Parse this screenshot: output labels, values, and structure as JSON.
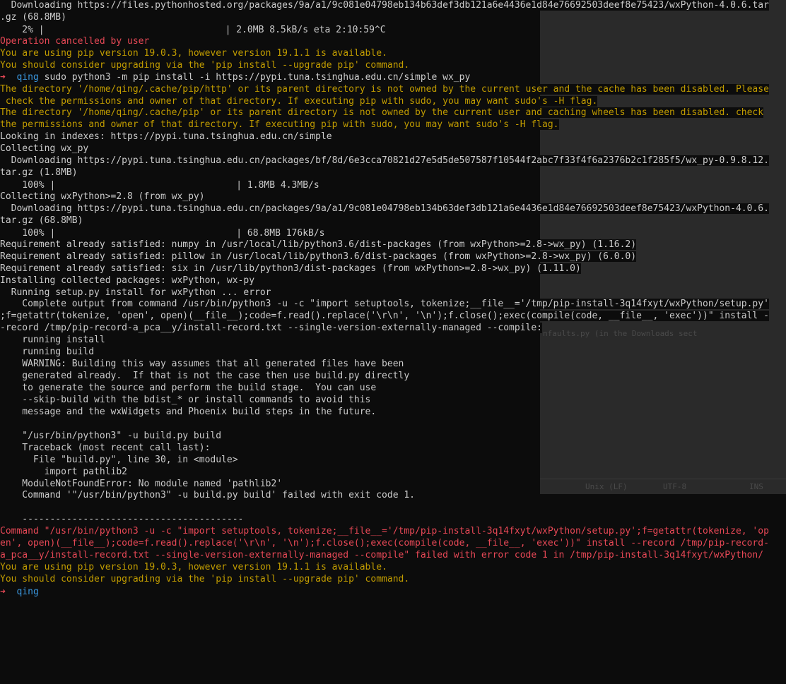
{
  "terminal": {
    "lines": [
      {
        "type": "normal",
        "text": "  Downloading https://files.pythonhosted.org/packages/9a/a1/9c081e04798eb134b63def3db121a6e4436e1d84e76692503deef8e75423/wxPython-4.0.6.tar"
      },
      {
        "type": "normal",
        "text": ".gz (68.8MB)"
      },
      {
        "type": "progress",
        "prefix": "    2% ",
        "fill": 0.02,
        "suffix": " 2.0MB 8.5kB/s eta 2:10:59^C"
      },
      {
        "type": "red",
        "text": "Operation cancelled by user"
      },
      {
        "type": "yellow",
        "text": "You are using pip version 19.0.3, however version 19.1.1 is available."
      },
      {
        "type": "yellow",
        "text": "You should consider upgrading via the 'pip install --upgrade pip' command."
      },
      {
        "type": "prompt",
        "arrow": "➜",
        "user": "qing",
        "command": " sudo python3 -m pip install -i https://pypi.tuna.tsinghua.edu.cn/simple wx_py"
      },
      {
        "type": "yellow",
        "text": "The directory '/home/qing/.cache/pip/http' or its parent directory is not owned by the current user and the cache has been disabled. Please"
      },
      {
        "type": "yellow",
        "text": " check the permissions and owner of that directory. If executing pip with sudo, you may want sudo's -H flag."
      },
      {
        "type": "yellow",
        "text": "The directory '/home/qing/.cache/pip' or its parent directory is not owned by the current user and caching wheels has been disabled. check"
      },
      {
        "type": "yellow",
        "text": "the permissions and owner of that directory. If executing pip with sudo, you may want sudo's -H flag."
      },
      {
        "type": "normal",
        "text": "Looking in indexes: https://pypi.tuna.tsinghua.edu.cn/simple"
      },
      {
        "type": "normal",
        "text": "Collecting wx_py"
      },
      {
        "type": "normal",
        "text": "  Downloading https://pypi.tuna.tsinghua.edu.cn/packages/bf/8d/6e3cca70821d27e5d5de507587f10544f2abc7f33f4f6a2376b2c1f285f5/wx_py-0.9.8.12."
      },
      {
        "type": "normal",
        "text": "tar.gz (1.8MB)"
      },
      {
        "type": "progress",
        "prefix": "    100% ",
        "fill": 1.0,
        "suffix": " 1.8MB 4.3MB/s"
      },
      {
        "type": "normal",
        "text": "Collecting wxPython>=2.8 (from wx_py)"
      },
      {
        "type": "normal",
        "text": "  Downloading https://pypi.tuna.tsinghua.edu.cn/packages/9a/a1/9c081e04798eb134b63def3db121a6e4436e1d84e76692503deef8e75423/wxPython-4.0.6."
      },
      {
        "type": "normal",
        "text": "tar.gz (68.8MB)"
      },
      {
        "type": "progress",
        "prefix": "    100% ",
        "fill": 1.0,
        "suffix": " 68.8MB 176kB/s"
      },
      {
        "type": "normal",
        "text": "Requirement already satisfied: numpy in /usr/local/lib/python3.6/dist-packages (from wxPython>=2.8->wx_py) (1.16.2)"
      },
      {
        "type": "normal",
        "text": "Requirement already satisfied: pillow in /usr/local/lib/python3.6/dist-packages (from wxPython>=2.8->wx_py) (6.0.0)"
      },
      {
        "type": "normal",
        "text": "Requirement already satisfied: six in /usr/lib/python3/dist-packages (from wxPython>=2.8->wx_py) (1.11.0)"
      },
      {
        "type": "normal",
        "text": "Installing collected packages: wxPython, wx-py"
      },
      {
        "type": "normal",
        "text": "  Running setup.py install for wxPython ... error"
      },
      {
        "type": "normal",
        "text": "    Complete output from command /usr/bin/python3 -u -c \"import setuptools, tokenize;__file__='/tmp/pip-install-3q14fxyt/wxPython/setup.py'"
      },
      {
        "type": "normal",
        "text": ";f=getattr(tokenize, 'open', open)(__file__);code=f.read().replace('\\r\\n', '\\n');f.close();exec(compile(code, __file__, 'exec'))\" install -"
      },
      {
        "type": "normal",
        "text": "-record /tmp/pip-record-a_pca__y/install-record.txt --single-version-externally-managed --compile:"
      },
      {
        "type": "normal",
        "text": "    running install"
      },
      {
        "type": "normal",
        "text": "    running build"
      },
      {
        "type": "normal",
        "text": "    WARNING: Building this way assumes that all generated files have been"
      },
      {
        "type": "normal",
        "text": "    generated already.  If that is not the case then use build.py directly"
      },
      {
        "type": "normal",
        "text": "    to generate the source and perform the build stage.  You can use"
      },
      {
        "type": "normal",
        "text": "    --skip-build with the bdist_* or install commands to avoid this"
      },
      {
        "type": "normal",
        "text": "    message and the wxWidgets and Phoenix build steps in the future."
      },
      {
        "type": "normal",
        "text": ""
      },
      {
        "type": "normal",
        "text": "    \"/usr/bin/python3\" -u build.py build"
      },
      {
        "type": "normal",
        "text": "    Traceback (most recent call last):"
      },
      {
        "type": "normal",
        "text": "      File \"build.py\", line 30, in <module>"
      },
      {
        "type": "normal",
        "text": "        import pathlib2"
      },
      {
        "type": "normal",
        "text": "    ModuleNotFoundError: No module named 'pathlib2'"
      },
      {
        "type": "normal",
        "text": "    Command '\"/usr/bin/python3\" -u build.py build' failed with exit code 1."
      },
      {
        "type": "normal",
        "text": ""
      },
      {
        "type": "normal",
        "text": "    ----------------------------------------"
      },
      {
        "type": "red",
        "text": "Command \"/usr/bin/python3 -u -c \"import setuptools, tokenize;__file__='/tmp/pip-install-3q14fxyt/wxPython/setup.py';f=getattr(tokenize, 'op"
      },
      {
        "type": "red",
        "text": "en', open)(__file__);code=f.read().replace('\\r\\n', '\\n');f.close();exec(compile(code, __file__, 'exec'))\" install --record /tmp/pip-record-"
      },
      {
        "type": "red",
        "text": "a_pca__y/install-record.txt --single-version-externally-managed --compile\" failed with error code 1 in /tmp/pip-install-3q14fxyt/wxPython/"
      },
      {
        "type": "yellow",
        "text": "You are using pip version 19.0.3, however version 19.1.1 is available."
      },
      {
        "type": "yellow",
        "text": "You should consider upgrading via the 'pip install --upgrade pip' command."
      },
      {
        "type": "prompt_cursor",
        "arrow": "➜",
        "user": "qing",
        "command": " "
      }
    ]
  },
  "background_window": {
    "status_items": [
      "Unix (LF)",
      "UTF-8",
      "INS"
    ],
    "snippet": "nfaults.py (in the Downloads sect"
  },
  "colors": {
    "background": "#0c0c0c",
    "foreground": "#cccccc",
    "red": "#e74856",
    "yellow": "#c19c00",
    "user": "#3a96dd"
  },
  "icons": {
    "prompt_arrow": "arrow-right-icon",
    "progress_bar": "progress-bar"
  }
}
